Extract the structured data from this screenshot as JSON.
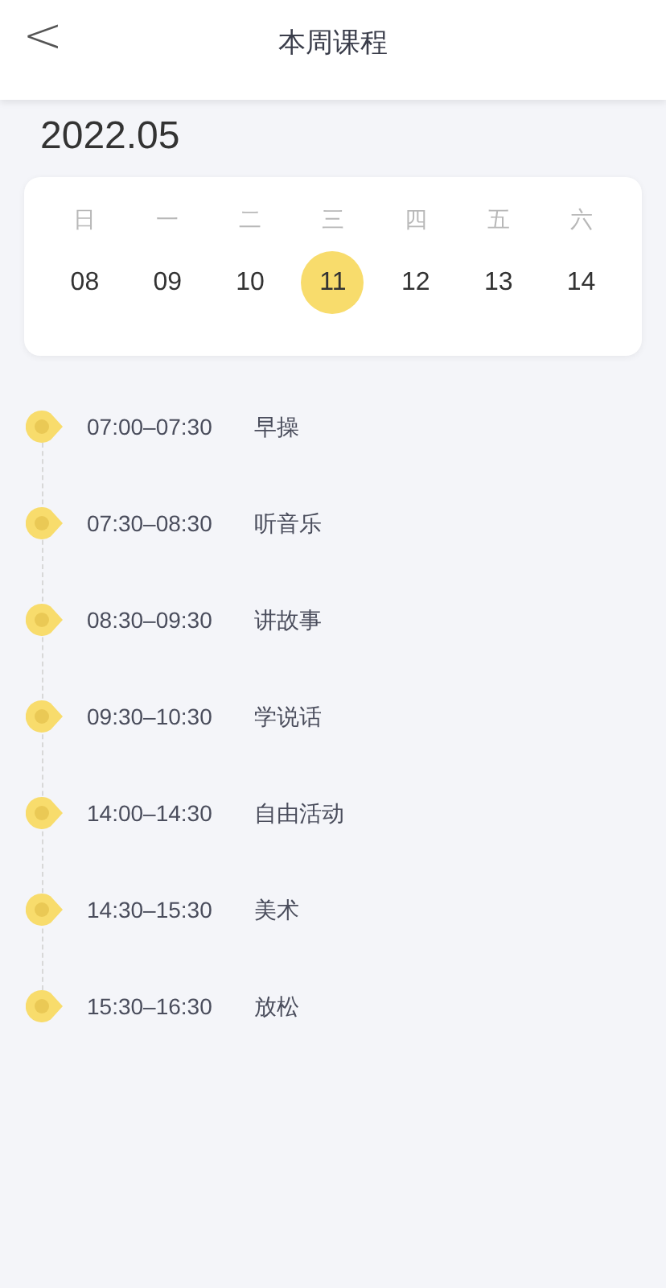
{
  "header": {
    "back": "<",
    "title": "本周课程"
  },
  "month": "2022.05",
  "week": [
    {
      "weekday": "日",
      "day": "08",
      "selected": false
    },
    {
      "weekday": "一",
      "day": "09",
      "selected": false
    },
    {
      "weekday": "二",
      "day": "10",
      "selected": false
    },
    {
      "weekday": "三",
      "day": "11",
      "selected": true
    },
    {
      "weekday": "四",
      "day": "12",
      "selected": false
    },
    {
      "weekday": "五",
      "day": "13",
      "selected": false
    },
    {
      "weekday": "六",
      "day": "14",
      "selected": false
    }
  ],
  "schedule": [
    {
      "time": "07:00–07:30",
      "course": "早操"
    },
    {
      "time": "07:30–08:30",
      "course": "听音乐"
    },
    {
      "time": "08:30–09:30",
      "course": "讲故事"
    },
    {
      "time": "09:30–10:30",
      "course": "学说话"
    },
    {
      "time": "14:00–14:30",
      "course": "自由活动"
    },
    {
      "time": "14:30–15:30",
      "course": "美术"
    },
    {
      "time": "15:30–16:30",
      "course": "放松"
    }
  ]
}
